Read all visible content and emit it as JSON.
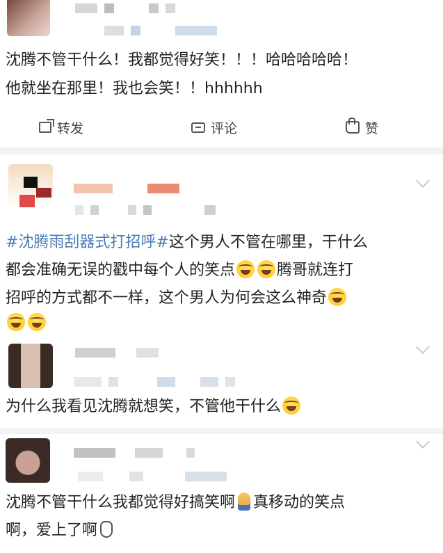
{
  "posts": [
    {
      "text_lines": [
        "沈腾不管干什么！我都觉得好笑！！！哈哈哈哈哈！",
        "他就坐在那里！我也会笑！！hhhhhh"
      ],
      "actions": {
        "repost": "转发",
        "comment": "评论",
        "like": "赞"
      }
    },
    {
      "hashtag": "#沈腾雨刮器式打招呼#",
      "text_line1_rest": "这个男人不管在哪里，干什么",
      "text_line2": "都会准确无误的戳中每个人的笑点",
      "text_line2_tail": "腾哥就连打",
      "text_line3": "招呼的方式都不一样，这个男人为何会这么神奇"
    },
    {
      "text": "为什么我看见沈腾就想笑，不管他干什么"
    },
    {
      "text_line1": "沈腾不管干什么我都觉得好搞笑啊",
      "text_line1_tail": "真移动的笑点",
      "text_line2": "啊，爱上了啊"
    }
  ],
  "icons": [
    "repost-icon",
    "comment-icon",
    "like-icon",
    "chevron-down-icon",
    "laugh-emoji",
    "pray-emoji",
    "wave-emoji"
  ],
  "colors": {
    "hashtag": "#4a7bb7",
    "separator": "#f2f2f2",
    "text": "#222222"
  }
}
